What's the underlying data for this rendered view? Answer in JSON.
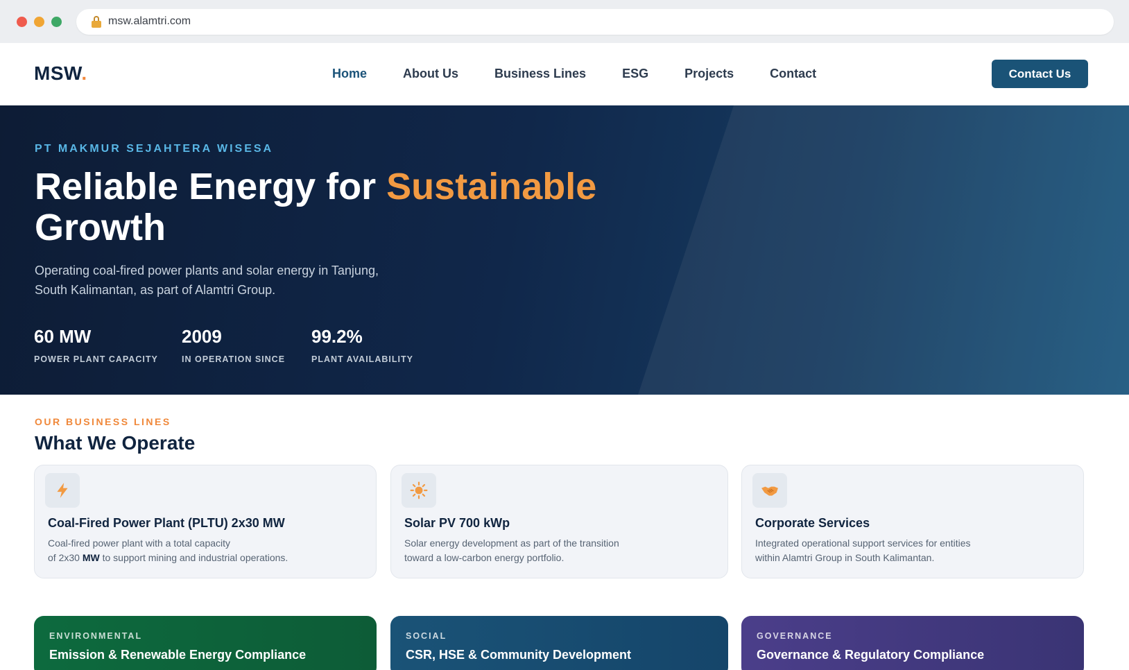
{
  "browser": {
    "url": "msw.alamtri.com"
  },
  "nav": {
    "logo": "MSW",
    "logo_dot": ".",
    "links": [
      "Home",
      "About Us",
      "Business Lines",
      "ESG",
      "Projects",
      "Contact"
    ],
    "active": "Home",
    "cta_label": "Contact Us"
  },
  "hero": {
    "eyebrow": "PT MAKMUR SEJAHTERA WISESA",
    "title_part1": "Reliable Energy for ",
    "title_accent": "Sustainable",
    "title_part2": "Growth",
    "subtitle_line1": "Operating coal-fired power plants and solar energy in Tanjung,",
    "subtitle_line2": "South Kalimantan, as part of Alamtri Group.",
    "stats": [
      {
        "value": "60 MW",
        "label": "POWER PLANT CAPACITY"
      },
      {
        "value": "2009",
        "label": "IN OPERATION SINCE"
      },
      {
        "value": "99.2%",
        "label": "PLANT AVAILABILITY"
      }
    ]
  },
  "business": {
    "eyebrow": "OUR BUSINESS LINES",
    "title": "What We Operate",
    "cards": [
      {
        "icon": "lightning-icon",
        "title": "Coal-Fired Power Plant (PLTU) 2x30 MW",
        "desc_line1": "Coal-fired power plant with a total capacity",
        "desc_line2_pre": "of 2x30 ",
        "desc_line2_bold": "MW",
        "desc_line2_post": " to support mining and industrial operations."
      },
      {
        "icon": "sun-icon",
        "title": "Solar PV 700 kWp",
        "desc_line1": "Solar energy development as part of the transition",
        "desc_line2": "toward a low-carbon energy portfolio."
      },
      {
        "icon": "handshake-icon",
        "title": "Corporate Services",
        "desc_line1": "Integrated operational support services for entities",
        "desc_line2": "within Alamtri Group in South Kalimantan."
      }
    ]
  },
  "esg": [
    {
      "tag": "ENVIRONMENTAL",
      "title": "Emission & Renewable Energy Compliance",
      "color": "#0d6a3e"
    },
    {
      "tag": "SOCIAL",
      "title": "CSR, HSE & Community Development",
      "color": "#1a5377"
    },
    {
      "tag": "GOVERNANCE",
      "title": "Governance & Regulatory Compliance",
      "color": "#4b3e8a"
    }
  ],
  "colors": {
    "accent": "#f29a42",
    "brand": "#1a5377",
    "navy": "#10243f"
  }
}
